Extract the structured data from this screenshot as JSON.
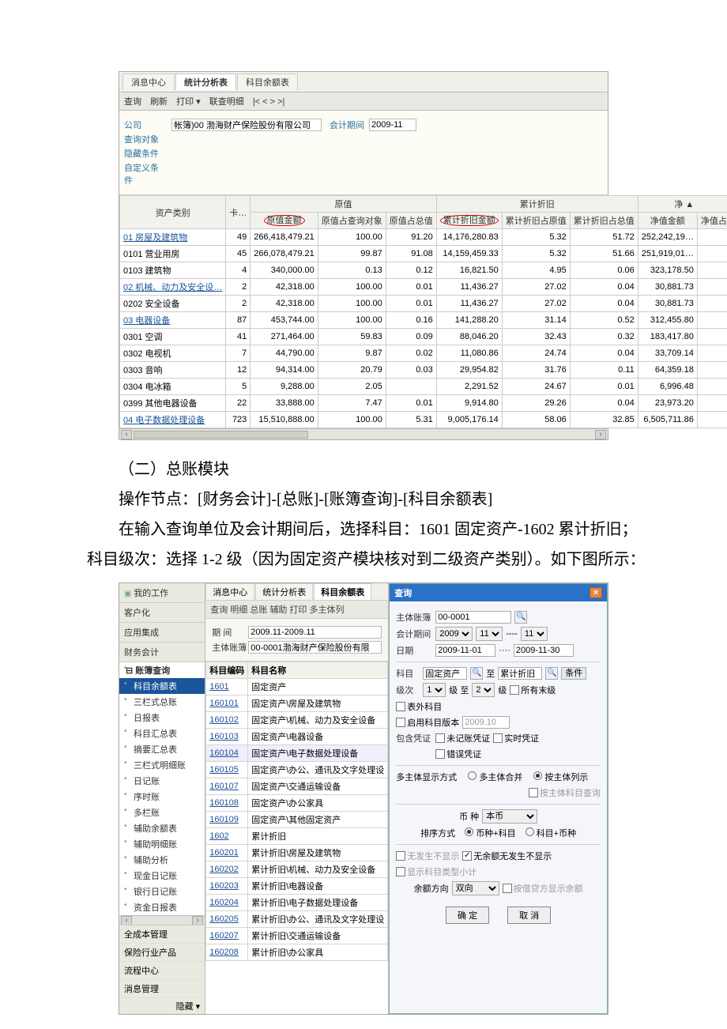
{
  "s1": {
    "tabs": [
      "消息中心",
      "统计分析表",
      "科目余额表"
    ],
    "toolbar": {
      "q": "查询",
      "r": "刷新",
      "p": "打印 ▾",
      "lc": "联查明细",
      "nav": "|<   <    >   >|"
    },
    "filter": {
      "company_lbl": "公司",
      "company_val": "帐簿)00 渤海财产保险股份有限公司",
      "period_lbl": "会计期间",
      "period_val": "2009-11",
      "obj_lbl": "查询对象",
      "hide_lbl": "隐藏条件",
      "custom_lbl": "自定义条件"
    },
    "headers": {
      "cat": "资产类别",
      "card": "卡…",
      "yz_group": "原值",
      "ljzj_group": "累计折旧",
      "jz_group": "净 ▲",
      "yzje": "原值金额",
      "yzzcx": "原值占查询对象",
      "yzzzz": "原值占总值",
      "ljzjje": "累计折旧金额",
      "ljzjzyz": "累计折旧占原值",
      "ljzjzzz": "累计折旧占总值",
      "jzje": "净值金额",
      "jzz": "净值占"
    },
    "rows": [
      {
        "cat": "01 房屋及建筑物",
        "card": "49",
        "yzje": "266,418,479.21",
        "yzzcx": "100.00",
        "yzzzz": "91.20",
        "ljzjje": "14,176,280.83",
        "ljzjzyz": "5.32",
        "ljzjzzz": "51.72",
        "jzje": "252,242,19…"
      },
      {
        "cat": "0101 营业用房",
        "card": "45",
        "yzje": "266,078,479.21",
        "yzzcx": "99.87",
        "yzzzz": "91.08",
        "ljzjje": "14,159,459.33",
        "ljzjzyz": "5.32",
        "ljzjzzz": "51.66",
        "jzje": "251,919,01…"
      },
      {
        "cat": "0103 建筑物",
        "card": "4",
        "yzje": "340,000.00",
        "yzzcx": "0.13",
        "yzzzz": "0.12",
        "ljzjje": "16,821.50",
        "ljzjzyz": "4.95",
        "ljzjzzz": "0.06",
        "jzje": "323,178.50"
      },
      {
        "cat": "02 机械、动力及安全设…",
        "card": "2",
        "yzje": "42,318.00",
        "yzzcx": "100.00",
        "yzzzz": "0.01",
        "ljzjje": "11,436.27",
        "ljzjzyz": "27.02",
        "ljzjzzz": "0.04",
        "jzje": "30,881.73"
      },
      {
        "cat": "0202 安全设备",
        "card": "2",
        "yzje": "42,318.00",
        "yzzcx": "100.00",
        "yzzzz": "0.01",
        "ljzjje": "11,436.27",
        "ljzjzyz": "27.02",
        "ljzjzzz": "0.04",
        "jzje": "30,881.73"
      },
      {
        "cat": "03 电器设备",
        "card": "87",
        "yzje": "453,744.00",
        "yzzcx": "100.00",
        "yzzzz": "0.16",
        "ljzjje": "141,288.20",
        "ljzjzyz": "31.14",
        "ljzjzzz": "0.52",
        "jzje": "312,455.80"
      },
      {
        "cat": "0301 空调",
        "card": "41",
        "yzje": "271,464.00",
        "yzzcx": "59.83",
        "yzzzz": "0.09",
        "ljzjje": "88,046.20",
        "ljzjzyz": "32.43",
        "ljzjzzz": "0.32",
        "jzje": "183,417.80"
      },
      {
        "cat": "0302 电视机",
        "card": "7",
        "yzje": "44,790.00",
        "yzzcx": "9.87",
        "yzzzz": "0.02",
        "ljzjje": "11,080.86",
        "ljzjzyz": "24.74",
        "ljzjzzz": "0.04",
        "jzje": "33,709.14"
      },
      {
        "cat": "0303 音响",
        "card": "12",
        "yzje": "94,314.00",
        "yzzcx": "20.79",
        "yzzzz": "0.03",
        "ljzjje": "29,954.82",
        "ljzjzyz": "31.76",
        "ljzjzzz": "0.11",
        "jzje": "64,359.18"
      },
      {
        "cat": "0304 电冰箱",
        "card": "5",
        "yzje": "9,288.00",
        "yzzcx": "2.05",
        "yzzzz": "",
        "ljzjje": "2,291.52",
        "ljzjzyz": "24.67",
        "ljzjzzz": "0.01",
        "jzje": "6,996.48"
      },
      {
        "cat": "0399 其他电器设备",
        "card": "22",
        "yzje": "33,888.00",
        "yzzcx": "7.47",
        "yzzzz": "0.01",
        "ljzjje": "9,914.80",
        "ljzjzyz": "29.26",
        "ljzjzzz": "0.04",
        "jzje": "23,973.20"
      },
      {
        "cat": "04 电子数据处理设备",
        "card": "723",
        "yzje": "15,510,888.00",
        "yzzcx": "100.00",
        "yzzzz": "5.31",
        "ljzjje": "9,005,176.14",
        "ljzjzyz": "58.06",
        "ljzjzzz": "32.85",
        "jzje": "6,505,711.86"
      }
    ]
  },
  "text": {
    "h1": "（二）总账模块",
    "p1": "操作节点：[财务会计]-[总账]-[账簿查询]-[科目余额表]",
    "p2": "在输入查询单位及会计期间后，选择科目：1601 固定资产-1602 累计折旧；科目级次：选择 1-2 级（因为固定资产模块核对到二级资产类别）。如下图所示："
  },
  "s2": {
    "left": {
      "mywork": "我的工作",
      "navitems": [
        "客户化",
        "应用集成",
        "财务会计"
      ],
      "tree_root": "账簿查询",
      "tree": [
        "科目余额表",
        "三栏式总账",
        "日报表",
        "科目汇总表",
        "摘要汇总表",
        "三栏式明细账",
        "日记账",
        "序时账",
        "多栏账",
        "辅助余额表",
        "辅助明细账",
        "辅助分析",
        "现金日记账",
        "银行日记账",
        "资金日报表"
      ],
      "bottom": [
        "全成本管理",
        "保险行业产品",
        "流程中心",
        "消息管理"
      ],
      "hide": "隐藏 ▾"
    },
    "center": {
      "tabs": [
        "消息中心",
        "统计分析表",
        "科目余额表"
      ],
      "sub": "查询   明细    总账   辅助   打印    多主体列",
      "period_lbl": "期 间",
      "period_val": "2009.11-2009.11",
      "book_lbl": "主体账簿",
      "book_val": "00-0001渤海财产保险股份有限",
      "th_code": "科目编码",
      "th_name": "科目名称",
      "rows": [
        {
          "c": "1601",
          "n": "固定资产"
        },
        {
          "c": "160101",
          "n": "固定资产\\房屋及建筑物"
        },
        {
          "c": "160102",
          "n": "固定资产\\机械、动力及安全设备"
        },
        {
          "c": "160103",
          "n": "固定资产\\电器设备"
        },
        {
          "c": "160104",
          "n": "固定资产\\电子数据处理设备"
        },
        {
          "c": "160105",
          "n": "固定资产\\办公、通讯及文字处理设"
        },
        {
          "c": "160107",
          "n": "固定资产\\交通运输设备"
        },
        {
          "c": "160108",
          "n": "固定资产\\办公家具"
        },
        {
          "c": "160109",
          "n": "固定资产\\其他固定资产"
        },
        {
          "c": "1602",
          "n": "累计折旧"
        },
        {
          "c": "160201",
          "n": "累计折旧\\房屋及建筑物"
        },
        {
          "c": "160202",
          "n": "累计折旧\\机械、动力及安全设备"
        },
        {
          "c": "160203",
          "n": "累计折旧\\电器设备"
        },
        {
          "c": "160204",
          "n": "累计折旧\\电子数据处理设备"
        },
        {
          "c": "160205",
          "n": "累计折旧\\办公、通讯及文字处理设"
        },
        {
          "c": "160207",
          "n": "累计折旧\\交通运输设备"
        },
        {
          "c": "160208",
          "n": "累计折旧\\办公家具"
        }
      ]
    },
    "right": {
      "title": "查询",
      "book_lbl": "主体账簿",
      "book_val": "00-0001",
      "period_lbl": "会计期间",
      "period_y": "2009",
      "period_m1": "11",
      "period_sep": "----",
      "period_m2": "11",
      "date_lbl": "日期",
      "date1": "2009-11-01",
      "date_sep": "····",
      "date2": "2009-11-30",
      "subj_lbl": "科目",
      "subj1": "固定资产",
      "subj_to": "至",
      "subj2": "累计折旧",
      "cond_btn": "条件",
      "level_lbl": "级次",
      "lv1": "1",
      "lv_to": "级 至",
      "lv2": "2",
      "lv_suffix": "级",
      "all_end_lbl": "所有末级",
      "out_subj_lbl": "表外科目",
      "enable_ver_lbl": "启用科目版本",
      "ver_val": "2009.10",
      "incl_lbl": "包含凭证",
      "unpost_lbl": "未记账凭证",
      "real_lbl": "实时凭证",
      "err_lbl": "错误凭证",
      "multi_lbl": "多主体显示方式",
      "radio1": "多主体合并",
      "radio2": "按主体列示",
      "by_subj_lbl": "按主体科目查询",
      "curr_lbl": "币 种",
      "curr_val": "本币",
      "sort_lbl": "排序方式",
      "sort1": "币种+科目",
      "sort2": "科目+币种",
      "noact_lbl": "无发生不显示",
      "nobal_lbl": "无余额无发生不显示",
      "showtype_lbl": "显示科目类型小计",
      "bal_lbl": "余额方向",
      "bal_val": "双向",
      "dc_lbl": "按借贷方显示余额",
      "ok": "确 定",
      "cancel": "取 消"
    }
  }
}
